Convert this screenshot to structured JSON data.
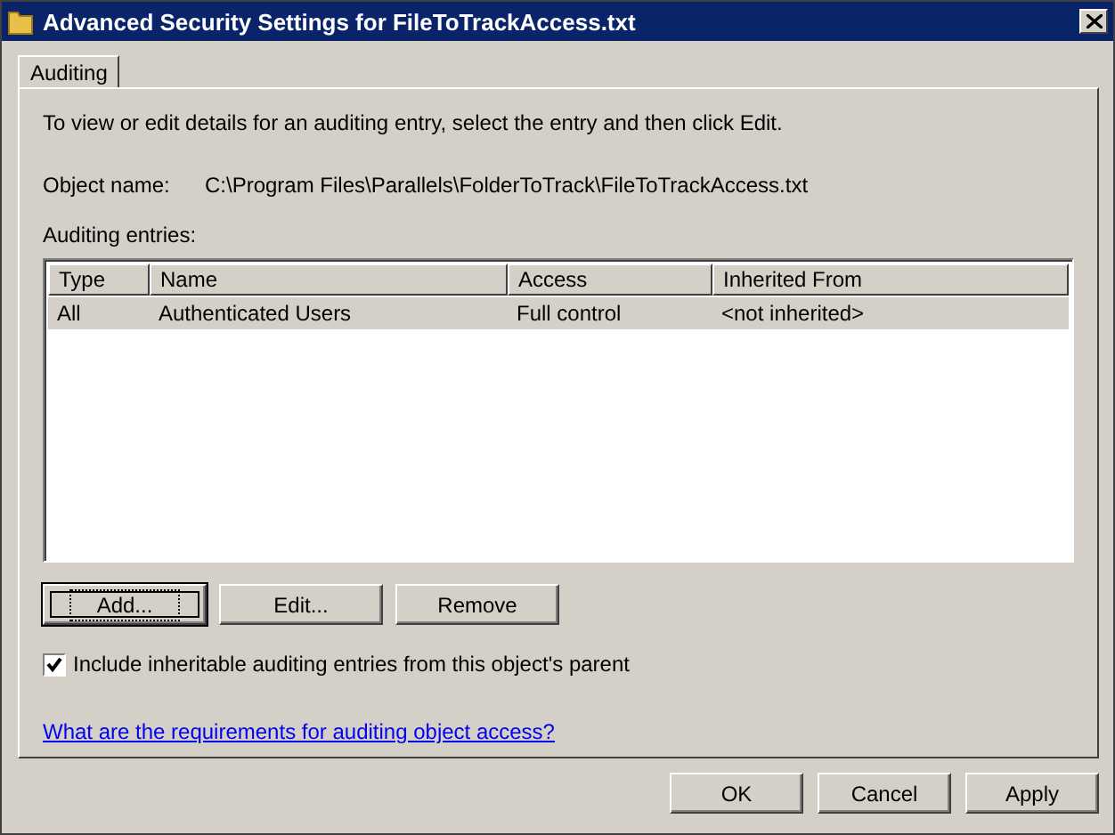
{
  "window": {
    "title": "Advanced Security Settings for FileToTrackAccess.txt"
  },
  "tabs": [
    {
      "label": "Auditing",
      "selected": true
    }
  ],
  "instructions": "To view or edit details for an auditing entry, select the entry and then click Edit.",
  "object_name": {
    "label": "Object name:",
    "value": "C:\\Program Files\\Parallels\\FolderToTrack\\FileToTrackAccess.txt"
  },
  "entries": {
    "label": "Auditing entries:",
    "columns": [
      "Type",
      "Name",
      "Access",
      "Inherited From"
    ],
    "rows": [
      {
        "cells": [
          "All",
          "Authenticated Users",
          "Full control",
          "<not inherited>"
        ],
        "selected": true
      }
    ]
  },
  "entry_buttons": [
    {
      "label": "Add...",
      "focused": true
    },
    {
      "label": "Edit...",
      "focused": false
    },
    {
      "label": "Remove",
      "focused": false
    }
  ],
  "inherit_checkbox": {
    "label": "Include inheritable auditing entries from this object's parent",
    "checked": true
  },
  "help_link": "What are the requirements for auditing object access?",
  "buttons": [
    "OK",
    "Cancel",
    "Apply"
  ]
}
